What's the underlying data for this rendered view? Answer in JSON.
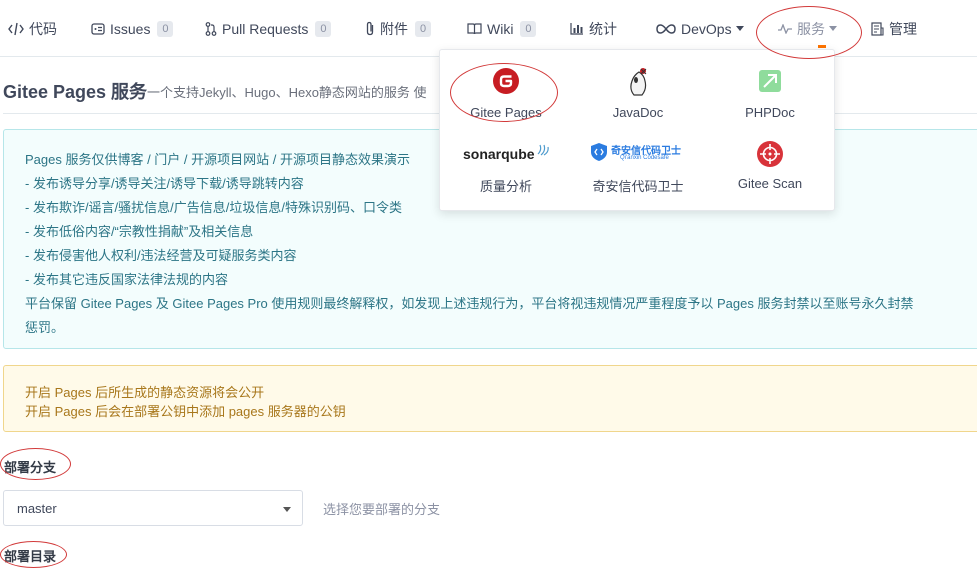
{
  "nav": {
    "code": "代码",
    "issues": "Issues",
    "issues_count": "0",
    "pull_requests": "Pull Requests",
    "pull_requests_count": "0",
    "attachments": "附件",
    "attachments_count": "0",
    "wiki": "Wiki",
    "wiki_count": "0",
    "stats": "统计",
    "devops": "DevOps",
    "service": "服务",
    "manage": "管理"
  },
  "services_menu": {
    "items": [
      {
        "label": "Gitee Pages",
        "icon": "gitee-pages-icon"
      },
      {
        "label": "JavaDoc",
        "icon": "javadoc-icon"
      },
      {
        "label": "PHPDoc",
        "icon": "phpdoc-icon"
      },
      {
        "label": "质量分析",
        "icon": "sonarqube-logo",
        "logo_text": "sonarqube"
      },
      {
        "label": "奇安信代码卫士",
        "icon": "qianxin-codesafe-logo",
        "logo_text": "奇安信代码卫士",
        "logo_subtext": "Qi'anxin Codesafe"
      },
      {
        "label": "Gitee Scan",
        "icon": "gitee-scan-icon"
      }
    ]
  },
  "header": {
    "title": "Gitee Pages 服务",
    "subtitle": "一个支持Jekyll、Hugo、Hexo静态网站的服务 使"
  },
  "notice": {
    "lines": [
      "Pages 服务仅供博客 / 门户 / 开源项目网站 / 开源项目静态效果演示",
      "- 发布诱导分享/诱导关注/诱导下载/诱导跳转内容",
      "- 发布欺诈/谣言/骚扰信息/广告信息/垃圾信息/特殊识别码、口令类",
      "- 发布低俗内容/“宗教性捐献”及相关信息",
      "- 发布侵害他人权利/违法经营及可疑服务类内容",
      "- 发布其它违反国家法律法规的内容",
      "平台保留 Gitee Pages 及 Gitee Pages Pro 使用规则最终解释权，如发现上述违规行为，平台将视违规情况严重程度予以 Pages 服务封禁以至账号永久封禁",
      "惩罚。"
    ]
  },
  "warning": {
    "lines": [
      "开启 Pages 后所生成的静态资源将会公开",
      "开启 Pages 后会在部署公钥中添加 pages 服务器的公钥"
    ]
  },
  "form": {
    "branch_label": "部署分支",
    "branch_value": "master",
    "branch_hint": "选择您要部署的分支",
    "dir_label": "部署目录"
  },
  "colors": {
    "annotation": "#d23a3a",
    "gitee_red": "#c71d23",
    "accent_orange": "#fe7300",
    "notice_text": "#2c7586",
    "warning_text": "#a8771b"
  }
}
